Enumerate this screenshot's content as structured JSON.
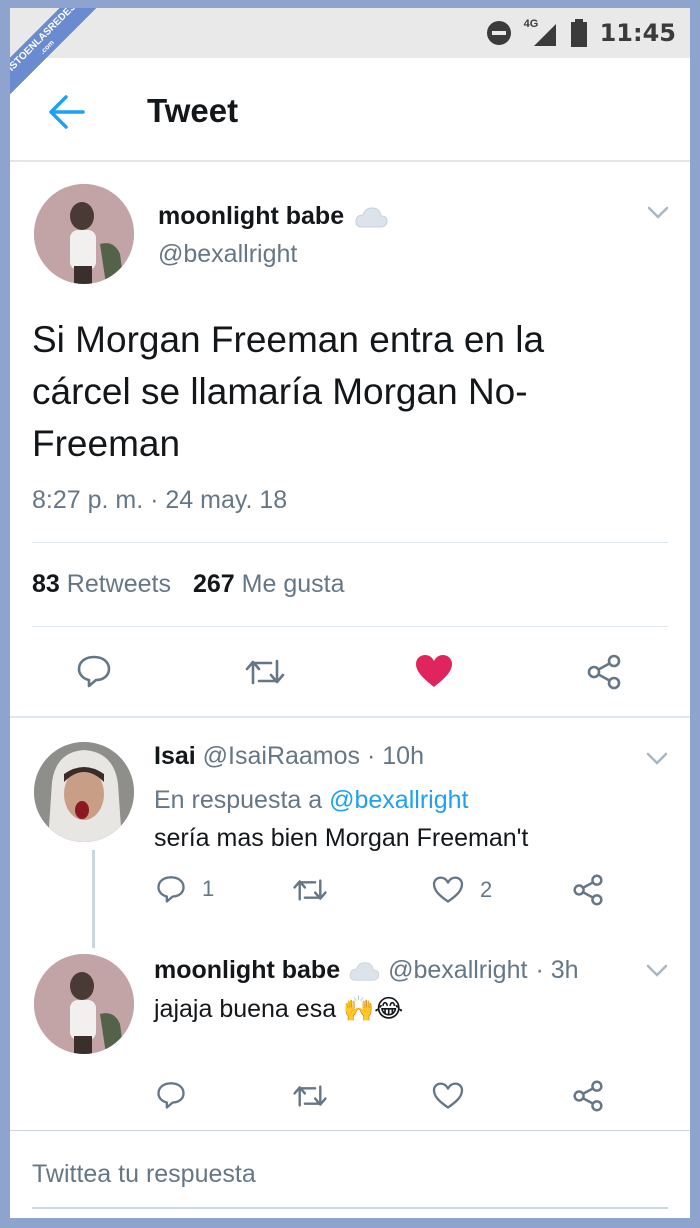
{
  "watermark": {
    "line1": "VISTOENLASREDES",
    "line2": ".com"
  },
  "status_bar": {
    "network": "4G",
    "time": "11:45"
  },
  "header": {
    "title": "Tweet"
  },
  "main_tweet": {
    "author_name": "moonlight babe",
    "author_handle": "@bexallright",
    "text": "Si Morgan Freeman entra en la cárcel se llamaría Morgan No-Freeman",
    "timestamp": "8:27 p. m. · 24 may. 18",
    "retweet_count": "83",
    "retweet_label": "Retweets",
    "like_count": "267",
    "like_label": "Me gusta"
  },
  "replies": [
    {
      "author_name": "Isai",
      "author_handle": "@IsaiRaamos",
      "time": "· 10h",
      "reply_prefix": "En respuesta a",
      "reply_to": "@bexallright",
      "text": "sería mas bien Morgan Freeman't",
      "reply_count": "1",
      "like_count": "2"
    },
    {
      "author_name": "moonlight babe",
      "author_handle": "@bexallright",
      "time": "· 3h",
      "text": "jajaja buena esa 🙌😂"
    }
  ],
  "reply_box": {
    "placeholder": "Twittea tu respuesta"
  },
  "colors": {
    "accent": "#1da1f2",
    "like": "#e0245e",
    "muted": "#657786",
    "text": "#14171a"
  }
}
